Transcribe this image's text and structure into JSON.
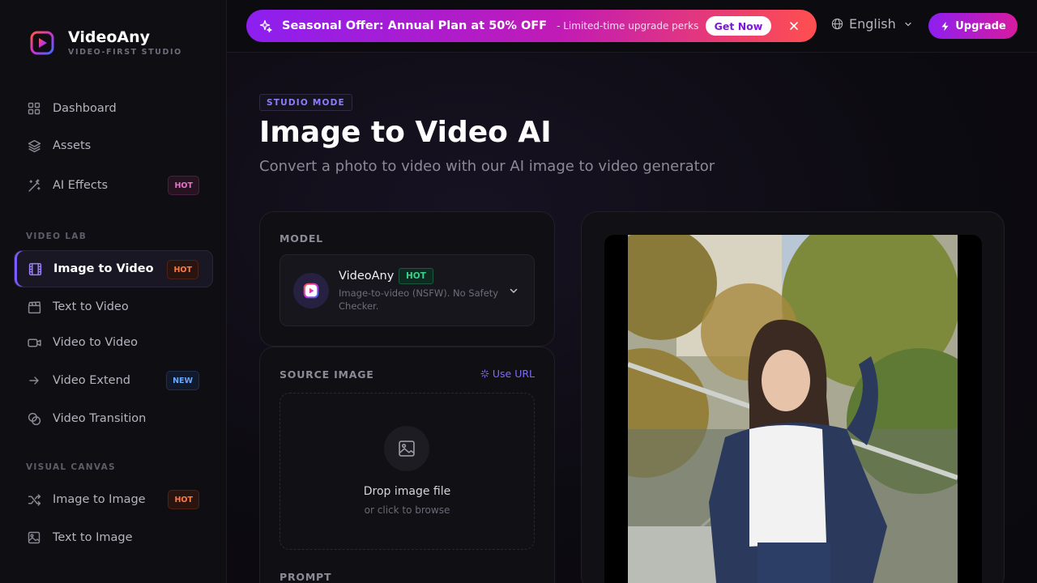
{
  "brand": {
    "name": "VideoAny",
    "tagline": "VIDEO-FIRST STUDIO"
  },
  "sidebar": {
    "items": [
      {
        "label": "Dashboard",
        "icon": "grid-icon"
      },
      {
        "label": "Assets",
        "icon": "layers-icon"
      },
      {
        "label": "AI Effects",
        "icon": "magic-wand-icon",
        "badge": "HOT"
      }
    ],
    "video_lab": {
      "label": "VIDEO LAB",
      "items": [
        {
          "label": "Image to Video",
          "icon": "film-icon",
          "badge": "HOT",
          "active": true
        },
        {
          "label": "Text to Video",
          "icon": "clapperboard-icon"
        },
        {
          "label": "Video to Video",
          "icon": "video-camera-icon"
        },
        {
          "label": "Video Extend",
          "icon": "arrow-right-icon",
          "badge": "NEW"
        },
        {
          "label": "Video Transition",
          "icon": "overlap-circles-icon"
        }
      ]
    },
    "visual_canvas": {
      "label": "VISUAL CANVAS",
      "items": [
        {
          "label": "Image to Image",
          "icon": "shuffle-icon",
          "badge": "HOT"
        },
        {
          "label": "Text to Image",
          "icon": "image-icon"
        }
      ]
    }
  },
  "promo": {
    "title": "Seasonal Offer: Annual Plan at 50% OFF",
    "subtitle": "- Limited-time upgrade perks",
    "cta": "Get Now"
  },
  "header": {
    "language": "English",
    "upgrade_label": "Upgrade"
  },
  "page": {
    "mode_chip": "STUDIO MODE",
    "title": "Image to Video AI",
    "subtitle": "Convert a photo to video with our AI image to video generator"
  },
  "model_card": {
    "label": "MODEL",
    "model_name": "VideoAny",
    "model_badge": "HOT",
    "model_description": "Image-to-video (NSFW). No Safety Checker."
  },
  "source_card": {
    "label": "SOURCE IMAGE",
    "use_url": "Use URL",
    "drop_title": "Drop image file",
    "drop_subtitle": "or click to browse"
  },
  "prompt_card": {
    "label": "PROMPT"
  },
  "colors": {
    "accent": "#7c5cff",
    "promo_start": "#8d1ff0",
    "promo_end": "#ff4f4f",
    "hot": "#ff7a45",
    "new": "#6aa6ff",
    "model_hot": "#35d48a"
  }
}
